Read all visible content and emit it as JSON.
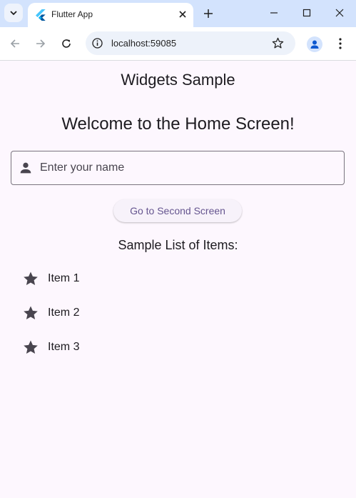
{
  "browser": {
    "tab_title": "Flutter App",
    "url": "localhost:59085",
    "accent": "#d3e3fd"
  },
  "app": {
    "appbar_title": "Widgets Sample",
    "headline": "Welcome to the Home Screen!",
    "name_field": {
      "placeholder": "Enter your name",
      "value": "",
      "icon": "person-icon"
    },
    "nav_button_label": "Go to Second Screen",
    "list_title": "Sample List of Items:",
    "items": [
      {
        "label": "Item 1",
        "icon": "star-icon"
      },
      {
        "label": "Item 2",
        "icon": "star-icon"
      },
      {
        "label": "Item 3",
        "icon": "star-icon"
      }
    ],
    "colors": {
      "background": "#fdf7fe",
      "primary": "#65558f",
      "text": "#1d1b20"
    }
  }
}
